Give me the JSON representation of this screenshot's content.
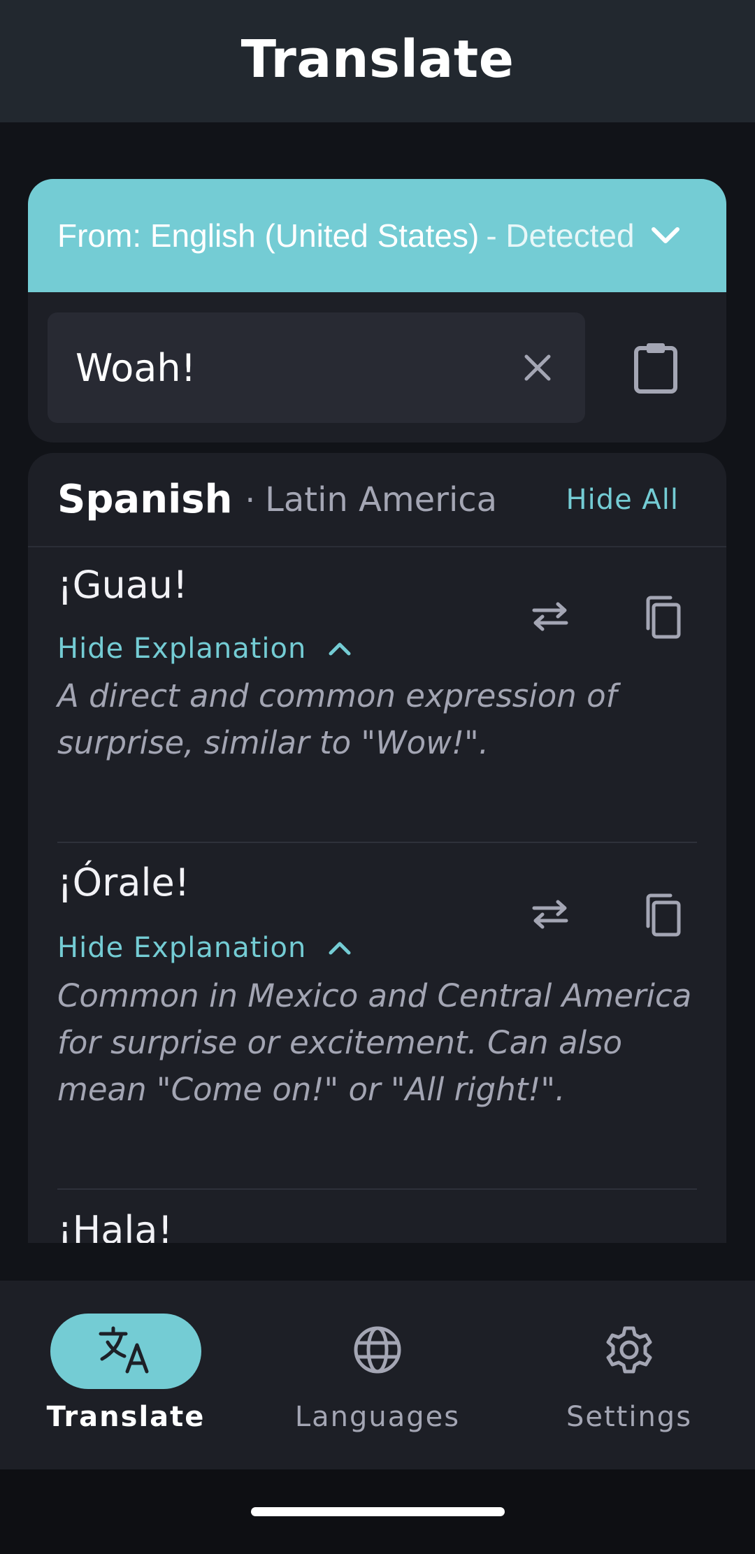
{
  "topbar": {
    "title": "Translate"
  },
  "source": {
    "from_label": "From: English (United States)",
    "detected_label": "- Detected",
    "input_value": "Woah!"
  },
  "results": {
    "language": "Spanish",
    "separator": "·",
    "region": "Latin America",
    "hide_all_label": "Hide All",
    "items": [
      {
        "phrase": "¡Guau!",
        "toggle_label": "Hide Explanation",
        "explanation": "A direct and common expression of surprise, similar to \"Wow!\"."
      },
      {
        "phrase": "¡Órale!",
        "toggle_label": "Hide Explanation",
        "explanation": "Common in Mexico and Central America for surprise or excitement. Can also mean \"Come on!\" or \"All right!\"."
      },
      {
        "phrase": "¡Hala!"
      }
    ]
  },
  "nav": {
    "items": [
      {
        "label": "Translate",
        "icon": "translate-icon",
        "active": true
      },
      {
        "label": "Languages",
        "icon": "globe-icon",
        "active": false
      },
      {
        "label": "Settings",
        "icon": "gear-icon",
        "active": false
      }
    ]
  },
  "colors": {
    "accent": "#74ccd4",
    "background": "#111318",
    "card": "#1d1f26",
    "topbar": "#22282f"
  }
}
